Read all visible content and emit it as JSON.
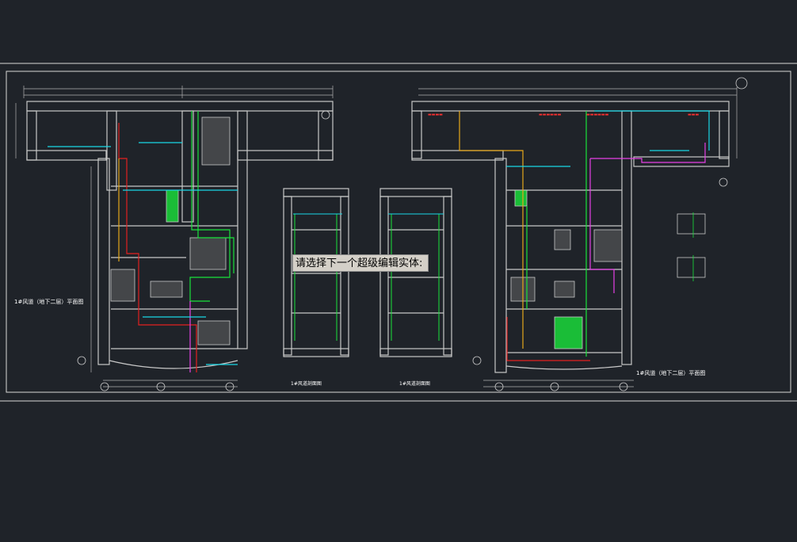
{
  "prompt": {
    "text": "请选择下一个超级编辑实体:"
  },
  "colors": {
    "background": "#1f2329",
    "frame": "#d8d8d8",
    "wall": "#c8c8c8",
    "duct_green": "#19e33b",
    "duct_cyan": "#19d7e6",
    "duct_red": "#e32020",
    "duct_magenta": "#e640e6",
    "duct_yellow": "#e6a81a",
    "text_red": "#ff3030"
  },
  "drawing": {
    "left_plan_title": "1#风道（地下二层）平面图",
    "right_plan_title": "1#风道（地下二层）平面图",
    "section_a_title": "1#风道剖面图",
    "section_b_title": "1#风道剖面图"
  }
}
